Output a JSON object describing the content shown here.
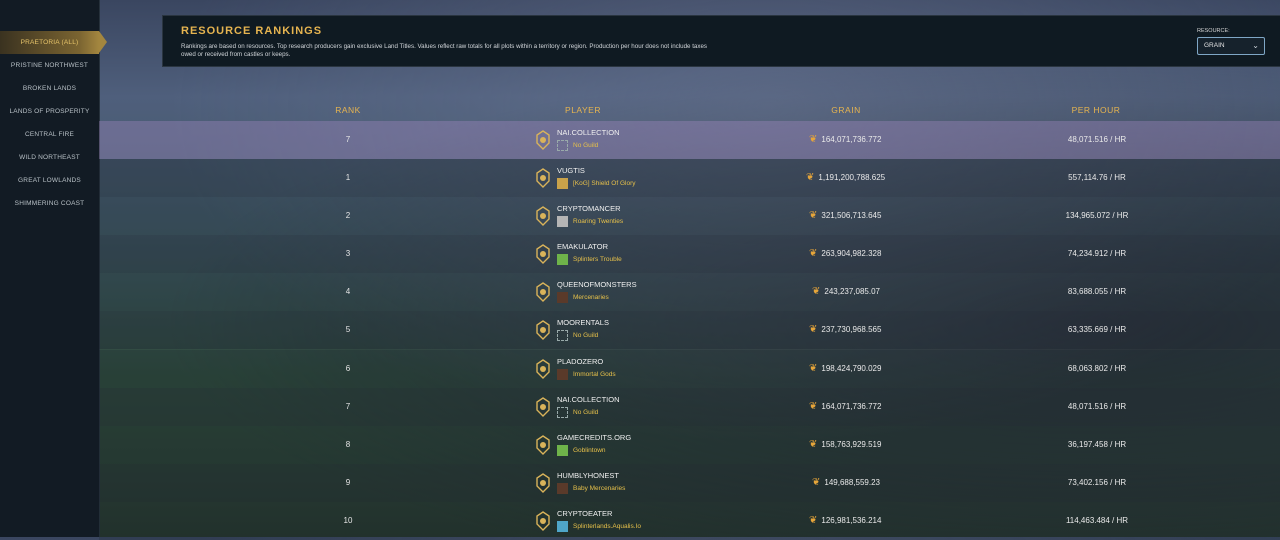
{
  "sidebar": {
    "items": [
      {
        "label": "PRAETORIA (ALL)",
        "active": true
      },
      {
        "label": "PRISTINE NORTHWEST",
        "active": false
      },
      {
        "label": "BROKEN LANDS",
        "active": false
      },
      {
        "label": "LANDS OF PROSPERITY",
        "active": false
      },
      {
        "label": "CENTRAL FIRE",
        "active": false
      },
      {
        "label": "WILD NORTHEAST",
        "active": false
      },
      {
        "label": "GREAT LOWLANDS",
        "active": false
      },
      {
        "label": "SHIMMERING COAST",
        "active": false
      }
    ]
  },
  "header": {
    "title": "RESOURCE RANKINGS",
    "description": "Rankings are based on resources. Top research producers gain exclusive Land Titles. Values reflect raw totals for all plots within a territory or region. Production per hour does not include taxes owed or received from castles or keeps.",
    "resource_label": "RESOURCE:",
    "resource_value": "GRAIN"
  },
  "columns": {
    "rank": "RANK",
    "player": "PLAYER",
    "grain": "GRAIN",
    "per_hour": "PER HOUR"
  },
  "colors": {
    "accent": "#e6b450",
    "guild": "#e6c04a",
    "highlight_row": "#8c73a8"
  },
  "rows": [
    {
      "rank": "7",
      "player": "NAI.COLLECTION",
      "guild": "No Guild",
      "guild_icon": "none",
      "grain": "164,071,736.772",
      "per_hour": "48,071.516 / HR",
      "highlight": true
    },
    {
      "rank": "1",
      "player": "VUGTIS",
      "guild": "[KoG] Shield Of Glory",
      "guild_icon": "shield",
      "grain": "1,191,200,788.625",
      "per_hour": "557,114.76 / HR"
    },
    {
      "rank": "2",
      "player": "CRYPTOMANCER",
      "guild": "Roaring Twenties",
      "guild_icon": "banner",
      "grain": "321,506,713.645",
      "per_hour": "134,965.072 / HR"
    },
    {
      "rank": "3",
      "player": "EMAKULATOR",
      "guild": "Splinters Trouble",
      "guild_icon": "green",
      "grain": "263,904,982.328",
      "per_hour": "74,234.912 / HR"
    },
    {
      "rank": "4",
      "player": "QUEENOFMONSTERS",
      "guild": "Mercenaries",
      "guild_icon": "dark",
      "grain": "243,237,085.07",
      "per_hour": "83,688.055 / HR"
    },
    {
      "rank": "5",
      "player": "MOORENTALS",
      "guild": "No Guild",
      "guild_icon": "none",
      "grain": "237,730,968.565",
      "per_hour": "63,335.669 / HR"
    },
    {
      "rank": "6",
      "player": "PLADOZERO",
      "guild": "Immortal Gods",
      "guild_icon": "dark",
      "grain": "198,424,790.029",
      "per_hour": "68,063.802 / HR"
    },
    {
      "rank": "7",
      "player": "NAI.COLLECTION",
      "guild": "No Guild",
      "guild_icon": "none",
      "grain": "164,071,736.772",
      "per_hour": "48,071.516 / HR"
    },
    {
      "rank": "8",
      "player": "GAMECREDITS.ORG",
      "guild": "Goblintown",
      "guild_icon": "green",
      "grain": "158,763,929.519",
      "per_hour": "36,197.458 / HR"
    },
    {
      "rank": "9",
      "player": "HUMBLYHONEST",
      "guild": "Baby Mercenaries",
      "guild_icon": "dark",
      "grain": "149,688,559.23",
      "per_hour": "73,402.156 / HR"
    },
    {
      "rank": "10",
      "player": "CRYPTOEATER",
      "guild": "Splinterlands.Aqualis.Io",
      "guild_icon": "blue",
      "grain": "126,981,536.214",
      "per_hour": "114,463.484 / HR"
    }
  ]
}
